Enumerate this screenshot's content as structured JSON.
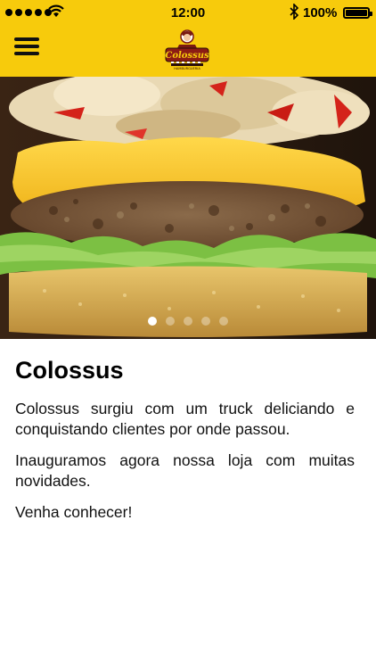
{
  "status_bar": {
    "time": "12:00",
    "battery": "100%",
    "icons": [
      "signal-dots",
      "wifi-icon",
      "bluetooth-icon",
      "battery-icon"
    ]
  },
  "header": {
    "menu_icon": "hamburger-menu-icon",
    "logo_text": "Colossus",
    "logo_subtext": "HAMBURGUERIA",
    "background": "#f7cb0c"
  },
  "carousel": {
    "slide_count": 5,
    "active_index": 0
  },
  "article": {
    "title": "Colossus",
    "paragraphs": [
      "Colossus surgiu com um truck deliciando e conquistando clientes por onde passou.",
      "Inauguramos agora nossa loja com muitas novidades.",
      "Venha conhecer!"
    ]
  }
}
